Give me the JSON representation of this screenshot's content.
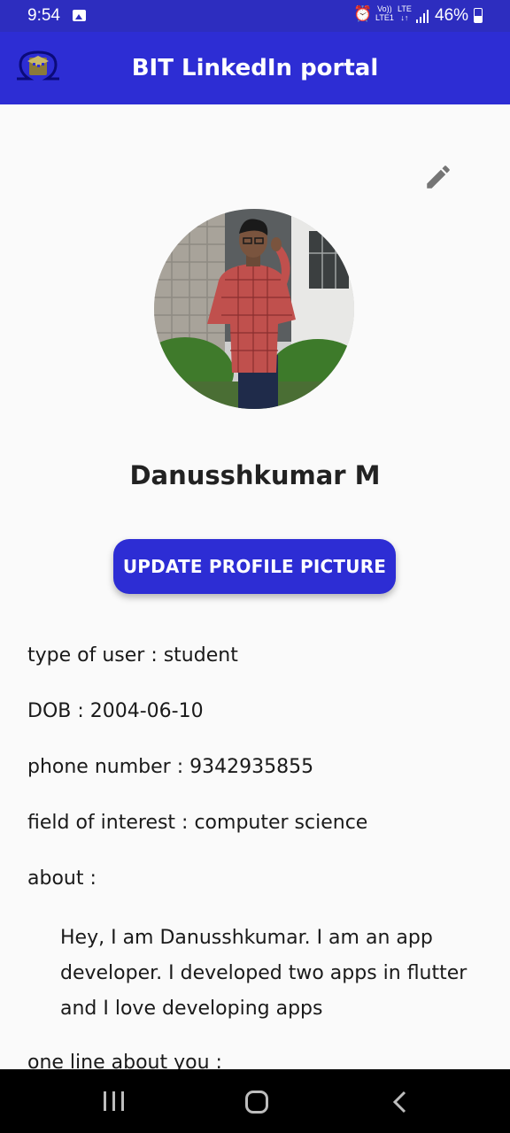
{
  "status_bar": {
    "time": "9:54",
    "volte_top": "Vo))",
    "volte_bottom": "LTE1",
    "lte_top": "LTE",
    "lte_bottom": "↓↑",
    "battery": "46%"
  },
  "app_bar": {
    "title": "BIT LinkedIn portal",
    "logo_icon": "bit-logo-icon"
  },
  "profile": {
    "name": "Danusshkumar M",
    "edit_icon": "pencil-icon",
    "update_button_label": "UPDATE PROFILE PICTURE"
  },
  "details": {
    "type_of_user": "type of user : student",
    "dob": "DOB : 2004-06-10",
    "phone": "phone number : 9342935855",
    "field_of_interest": "field of interest : computer science",
    "about_label": "about :",
    "about_text": "Hey, I am Danusshkumar. I am an app developer. I developed two apps in flutter and I love developing apps",
    "one_line_label": "one line about you :"
  },
  "nav_bar": {
    "recents_icon": "recents-icon",
    "home_icon": "home-icon",
    "back_icon": "back-icon"
  },
  "colors": {
    "primary": "#2d2dd4",
    "status_bar": "#2d2dbf",
    "background": "#fafafa"
  }
}
